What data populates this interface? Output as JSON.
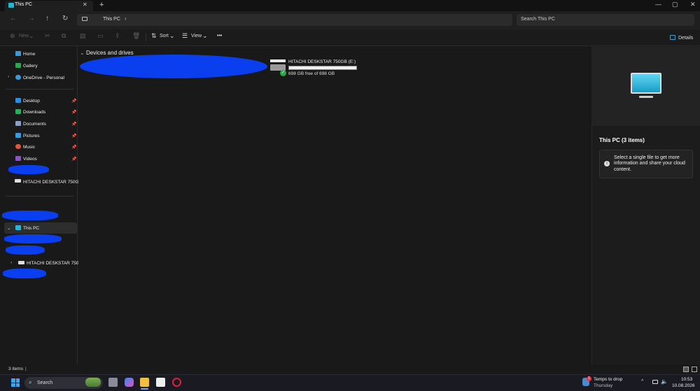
{
  "window": {
    "tab_title": "This PC",
    "tab_close": "✕",
    "tab_add": "+",
    "minimize": "—",
    "maximize": "▢",
    "close": "✕"
  },
  "nav": {
    "back": "←",
    "forward": "→",
    "up": "↑",
    "refresh": "↻",
    "address": "This PC",
    "address_chevron": "›",
    "search_placeholder": "Search This PC"
  },
  "toolbar": {
    "new_label": "New",
    "sort_label": "Sort",
    "view_label": "View",
    "more_label": "•••",
    "details_label": "Details"
  },
  "sidebar": {
    "home": "Home",
    "gallery": "Gallery",
    "onedrive": "OneDrive - Personal",
    "quick_access": [
      {
        "label": "Desktop",
        "icon": "desktop-folder-icon",
        "color": "#2a8ee0"
      },
      {
        "label": "Downloads",
        "icon": "downloads-folder-icon",
        "color": "#2ab05a"
      },
      {
        "label": "Documents",
        "icon": "documents-folder-icon",
        "color": "#8aa0c8"
      },
      {
        "label": "Pictures",
        "icon": "pictures-folder-icon",
        "color": "#3a9ae0"
      },
      {
        "label": "Music",
        "icon": "music-folder-icon",
        "color": "#e0563a"
      },
      {
        "label": "Videos",
        "icon": "videos-folder-icon",
        "color": "#8a50d0"
      }
    ],
    "pinned_drive": "HITACHI DESKSTAR 750GB (",
    "this_pc": "This PC",
    "tree_drive": "HITACHI DESKSTAR 750GB"
  },
  "main": {
    "section_title": "Devices and drives",
    "drive": {
      "name": "HITACHI DESKSTAR 750GB (E:)",
      "free_text": "698 GB free of 698 GB",
      "used_fraction": 0.0
    }
  },
  "details": {
    "title": "This PC (3 items)",
    "info": "Select a single file to get more information and share your cloud content."
  },
  "status": {
    "items": "3 items",
    "sep": "|"
  },
  "taskbar": {
    "search": "Search",
    "weather_title": "Temps to drop",
    "weather_sub": "Thursday",
    "weather_badge": "1",
    "time": "10:53",
    "date": "10.08.2026",
    "chevron": "^"
  },
  "colors": {
    "accent": "#0a3ff0",
    "monitor": "#27b4d8",
    "ok_green": "#2aa84a"
  }
}
